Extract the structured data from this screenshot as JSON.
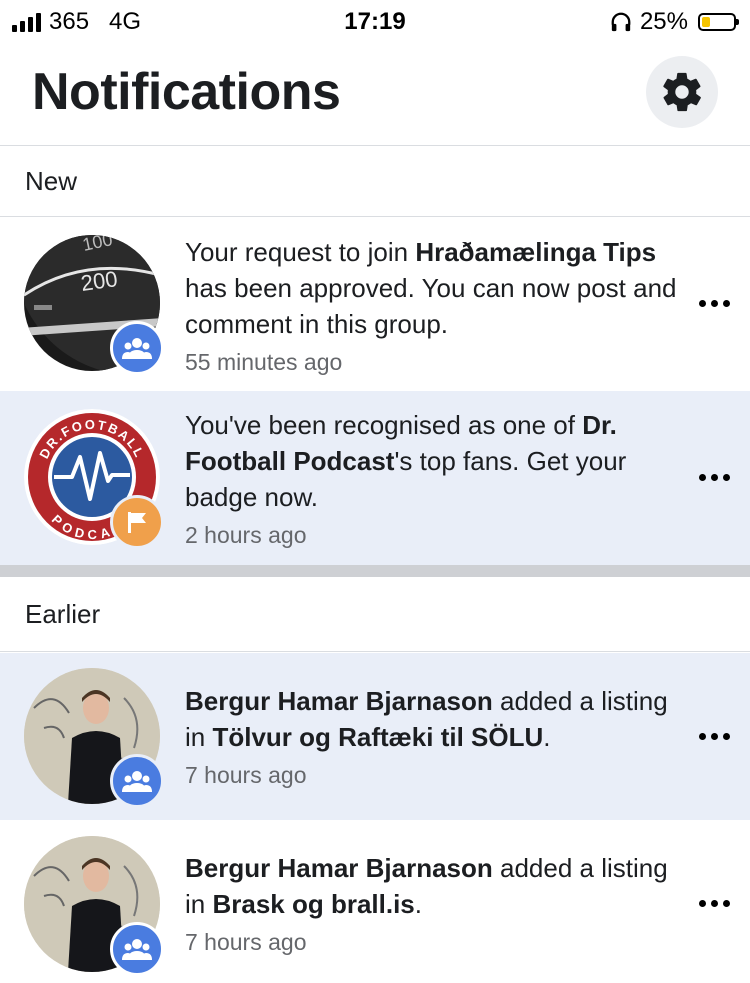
{
  "status_bar": {
    "carrier": "365",
    "network": "4G",
    "time": "17:19",
    "battery": "25%",
    "battery_level": 0.25,
    "battery_color": "#f5c400"
  },
  "header": {
    "title": "Notifications",
    "settings_icon": "gear-icon"
  },
  "sections": {
    "new_label": "New",
    "earlier_label": "Earlier"
  },
  "notifications": [
    {
      "parts": [
        "Your request to join ",
        "Hraðamælinga Tips",
        " has been approved. You can now post and comment in this group."
      ],
      "time": "55 minutes ago",
      "badge_icon": "group-icon",
      "badge_color": "#4a7ce0",
      "unread": false
    },
    {
      "parts": [
        "You've been recognised as one of ",
        "Dr. Football Podcast",
        "'s top fans. Get your badge now."
      ],
      "time": "2 hours ago",
      "badge_icon": "flag-icon",
      "badge_color": "#f0a04b",
      "unread": true,
      "logo_text_top": "DR.FOOTBALL",
      "logo_text_bottom": "PODCAST"
    },
    {
      "parts": [
        "Bergur Hamar Bjarnason",
        " added a listing in ",
        "Tölvur og Raftæki til SÖLU",
        "."
      ],
      "time": "7 hours ago",
      "badge_icon": "group-icon",
      "badge_color": "#4a7ce0",
      "unread": true
    },
    {
      "parts": [
        "Bergur Hamar Bjarnason",
        " added a listing in ",
        "Brask og brall.is",
        "."
      ],
      "time": "7 hours ago",
      "badge_icon": "group-icon",
      "badge_color": "#4a7ce0",
      "unread": false
    }
  ]
}
